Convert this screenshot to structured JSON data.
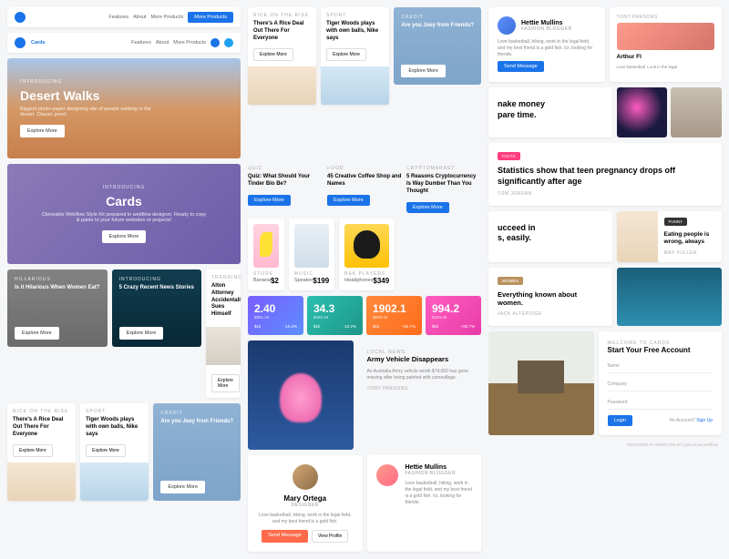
{
  "nav": {
    "features": "Features",
    "about": "About",
    "more": "More Products",
    "cta": "More Products",
    "brand": "Cards"
  },
  "hero1": {
    "lbl": "INTRODUCING",
    "title": "Desert Walks",
    "sub": "Biggest photo-paper designing site of people walking in the desert. Classic proof.",
    "btn": "Explore More"
  },
  "hero2": {
    "lbl": "INTRODUCING",
    "title": "Cards",
    "sub": "Cloneable Webflow Style Kit prepared in webflow designer. Ready to copy & paste to your future websites or projects!",
    "btn": "Explore More"
  },
  "small": [
    {
      "lbl": "HILLARIOUS",
      "title": "Is it Hilarious When Women Eat?",
      "btn": "Explore More"
    },
    {
      "lbl": "INTRODUCING",
      "title": "5 Crazy Recent News Stories",
      "btn": "Explore More"
    },
    {
      "lbl": "TRENDING",
      "title": "Alton Attorney Accidentally Sues Himself",
      "btn": "Explore More"
    }
  ],
  "bottom": [
    {
      "lbl": "RICE ON THE RISE",
      "title": "There's A Rice Deal Out There For Everyone",
      "btn": "Explore More"
    },
    {
      "lbl": "SPORT",
      "title": "Tiger Woods plays with own balls, Nike says",
      "btn": "Explore More"
    },
    {
      "lbl": "CREDIT",
      "title": "Are you Joey from Friends?",
      "btn": "Explore More"
    }
  ],
  "col2top": [
    {
      "lbl": "RICE ON THE RISE",
      "title": "There's A Rice Deal Out There For Everyone",
      "btn": "Explore More"
    },
    {
      "lbl": "SPORT",
      "title": "Tiger Woods plays with own balls, Nike says",
      "btn": "Explore More"
    },
    {
      "lbl": "CREDIT",
      "title": "Are you Joey from Friends?",
      "btn": "Explore More"
    }
  ],
  "articles": [
    {
      "lbl": "QUIZ",
      "title": "Quiz: What Should Your Tinder Bio Be?",
      "btn": "Explore More"
    },
    {
      "lbl": "FOOD",
      "title": "45 Creative Coffee Shop and Names",
      "btn": "Explore More"
    },
    {
      "lbl": "CRYPTOMARKET",
      "title": "5 Reasons Cryptocurrency Is Way Dumber Than You Thought",
      "btn": "Explore More"
    }
  ],
  "products": [
    {
      "lbl": "STORE",
      "name": "Banana",
      "price": "$2"
    },
    {
      "lbl": "MUSIC",
      "name": "Speaker",
      "price": "$199"
    },
    {
      "lbl": "B&K PLAYERS",
      "name": "Headphones",
      "price": "$349"
    }
  ],
  "stats": [
    {
      "n": "2.40",
      "s": "$991.34",
      "l": "$1k",
      "r": "-10.2%",
      "c": "linear-gradient(135deg,#7b5cff,#5c8fff)"
    },
    {
      "n": "34.3",
      "s": "$420.19",
      "l": "$1k",
      "r": "-10.2%",
      "c": "linear-gradient(135deg,#2bbfb0,#1e9688)"
    },
    {
      "n": "1902.1",
      "s": "$606.16",
      "l": "$1k",
      "r": "+92.7%",
      "c": "linear-gradient(135deg,#ff8a3d,#ff6b1a)"
    },
    {
      "n": "994.2",
      "s": "$328.48",
      "l": "$1k",
      "r": "+92.7%",
      "c": "linear-gradient(135deg,#ff5cc0,#e83ca8)"
    }
  ],
  "news": {
    "lbl": "LOCAL NEWS",
    "title": "Army Vehicle Disappears",
    "body": "An Australia Army vehicle worth $74,000 has gone missing after being painted with camouflage.",
    "author": "TONY PARSONS"
  },
  "profiles": [
    {
      "name": "Mary Ortega",
      "role": "DESIGNER",
      "bio": "Love basketball, hiking, work in the legal field, and my best friend is a gold fish.",
      "b1": "Send Message",
      "b2": "View Profile"
    },
    {
      "name": "Hettie Mullins",
      "role": "FASHION BLOGGER",
      "bio": "Love basketball, hiking, work in the legal field, and my best friend is a gold fish. Icr, looking for friends.",
      "b1": "Send Message"
    },
    {
      "name": "Arthur Fl",
      "bio": "Love basketball. Look in the legal"
    }
  ],
  "teasers": [
    {
      "title": "nake money\npare time."
    },
    {
      "title": "ucceed in\ns, easily."
    }
  ],
  "facts": [
    {
      "tag": "FACTS",
      "tc": "#ff3d7f",
      "title": "Statistics show that teen pregnancy drops off significantly after age",
      "author": "TOM JORDAN"
    },
    {
      "tag": "FUNNY",
      "tc": "#333",
      "title": "Eating people is wrong, always",
      "author": "MAX FULLER"
    },
    {
      "tag": "WOMEN",
      "tc": "#b8935f",
      "title": "Everything known about women.",
      "author": "JACK ALTERIDGE"
    }
  ],
  "form": {
    "lbl": "WELCOME TO CARDS",
    "title": "Start Your Free Account",
    "f1": "Name",
    "f2": "Company",
    "f3": "Password",
    "btn": "Login",
    "alt": "No Account?",
    "link": "Sign Up"
  },
  "footer": "DESIGNED IN WEBFLOW BY jankosmal.webflow"
}
